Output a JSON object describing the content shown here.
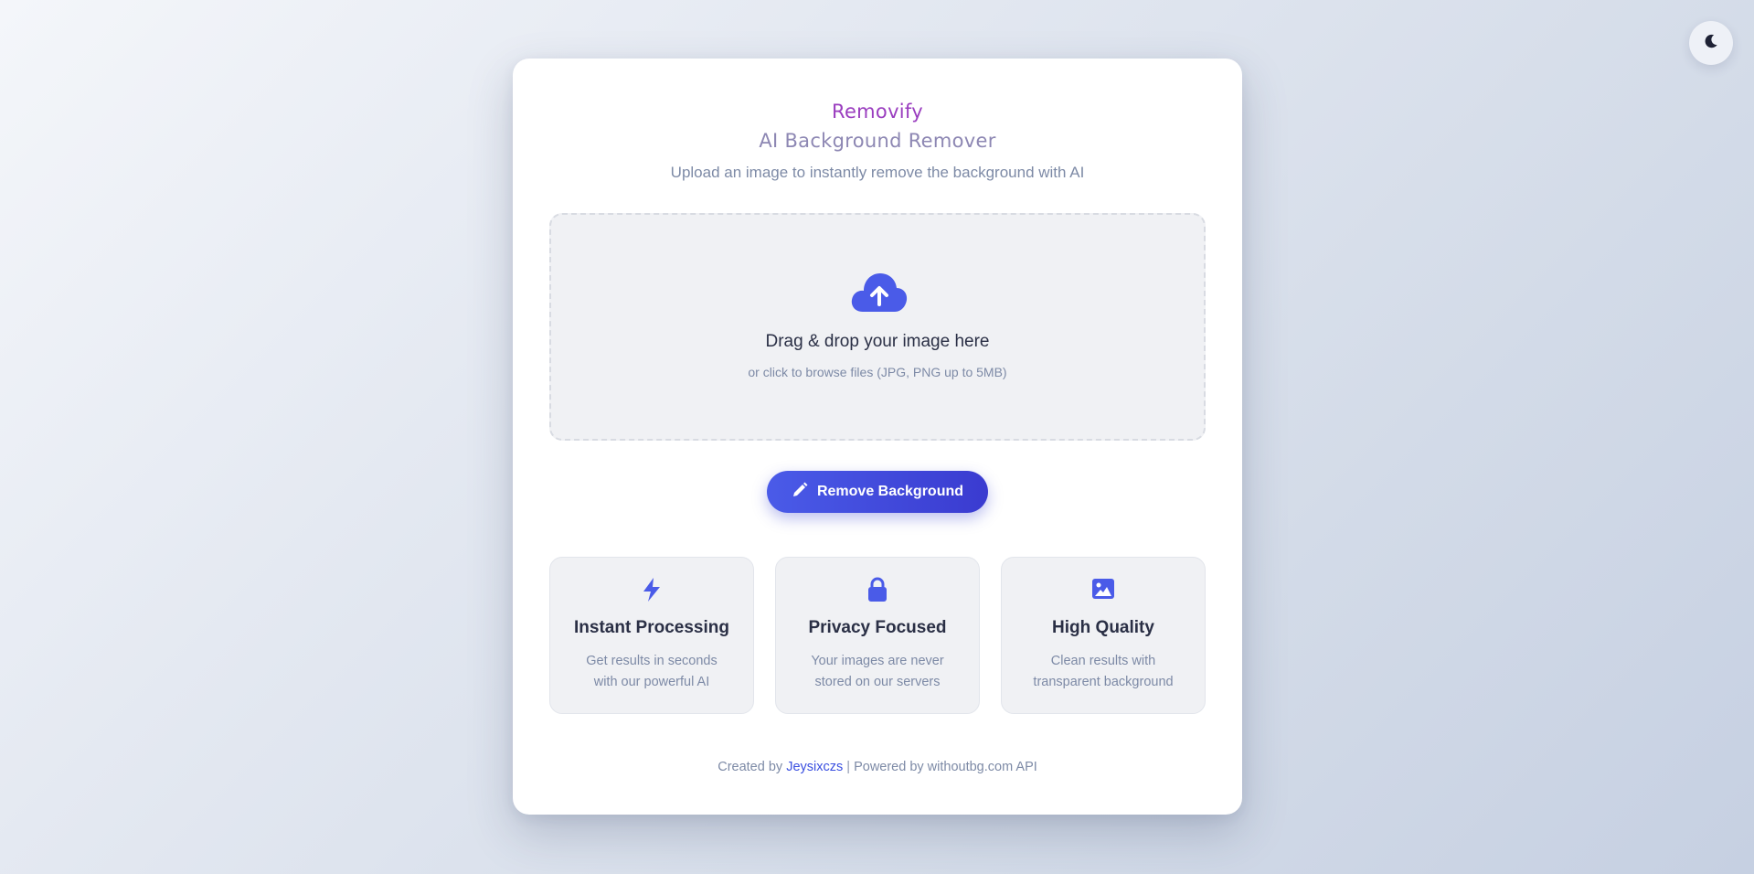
{
  "theme_toggle": {
    "icon": "moon-icon"
  },
  "header": {
    "brand": "Removify",
    "title": "AI Background Remover",
    "subtitle": "Upload an image to instantly remove the background with AI"
  },
  "dropzone": {
    "icon": "cloud-upload-icon",
    "title": "Drag & drop your image here",
    "hint": "or click to browse files (JPG, PNG up to 5MB)"
  },
  "action": {
    "label": "Remove Background",
    "icon": "pen-icon"
  },
  "features": [
    {
      "icon": "bolt-icon",
      "title": "Instant Processing",
      "line1": "Get results in seconds",
      "line2": "with our powerful AI"
    },
    {
      "icon": "lock-icon",
      "title": "Privacy Focused",
      "line1": "Your images are never",
      "line2": "stored on our servers"
    },
    {
      "icon": "image-icon",
      "title": "High Quality",
      "line1": "Clean results with",
      "line2": "transparent background"
    }
  ],
  "footer": {
    "prefix": "Created by",
    "author": "Jeysixczs",
    "separator": "|",
    "powered": "Powered by withoutbg.com API"
  },
  "colors": {
    "accent": "#4a5be8",
    "brand": "#9a3dbf",
    "title": "#8d87b3",
    "muted": "#7d8aa6",
    "heading": "#2a2f45"
  }
}
